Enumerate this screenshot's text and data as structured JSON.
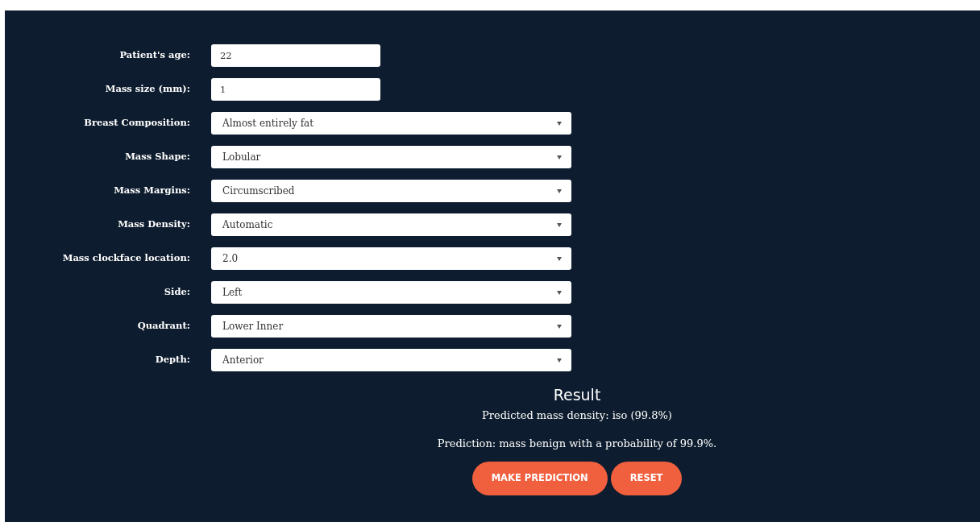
{
  "fields": [
    {
      "kind": "text",
      "label": "Patient's age:",
      "value": "22"
    },
    {
      "kind": "text",
      "label": "Mass size (mm):",
      "value": "1"
    },
    {
      "kind": "select",
      "label": "Breast Composition:",
      "value": "Almost entirely fat"
    },
    {
      "kind": "select",
      "label": "Mass Shape:",
      "value": "Lobular"
    },
    {
      "kind": "select",
      "label": "Mass Margins:",
      "value": "Circumscribed"
    },
    {
      "kind": "select",
      "label": "Mass Density:",
      "value": "Automatic"
    },
    {
      "kind": "select",
      "label": "Mass clockface location:",
      "value": "2.0"
    },
    {
      "kind": "select",
      "label": "Side:",
      "value": "Left"
    },
    {
      "kind": "select",
      "label": "Quadrant:",
      "value": "Lower Inner"
    },
    {
      "kind": "select",
      "label": "Depth:",
      "value": "Anterior"
    }
  ],
  "result": {
    "title": "Result",
    "density": "Predicted mass density: iso (99.8%)",
    "prediction": "Prediction: mass benign with a probability of 99.9%."
  },
  "buttons": [
    "MAKE PREDICTION",
    "RESET"
  ]
}
